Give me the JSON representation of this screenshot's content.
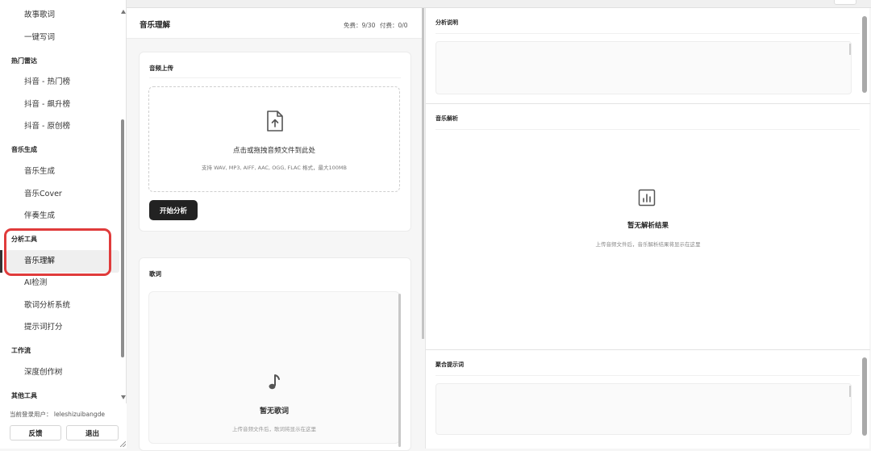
{
  "sidebar": {
    "items": [
      {
        "label": "故事歌词",
        "kind": "item"
      },
      {
        "label": "一键写词",
        "kind": "item"
      },
      {
        "label": "热门雷达",
        "kind": "group"
      },
      {
        "label": "抖音 - 热门榜",
        "kind": "item"
      },
      {
        "label": "抖音 - 飙升榜",
        "kind": "item"
      },
      {
        "label": "抖音 - 原创榜",
        "kind": "item"
      },
      {
        "label": "音乐生成",
        "kind": "group"
      },
      {
        "label": "音乐生成",
        "kind": "item"
      },
      {
        "label": "音乐Cover",
        "kind": "item"
      },
      {
        "label": "伴奏生成",
        "kind": "item"
      },
      {
        "label": "分析工具",
        "kind": "group"
      },
      {
        "label": "音乐理解",
        "kind": "item",
        "active": true
      },
      {
        "label": "AI检测",
        "kind": "item"
      },
      {
        "label": "歌词分析系统",
        "kind": "item"
      },
      {
        "label": "提示词打分",
        "kind": "item"
      },
      {
        "label": "工作流",
        "kind": "group"
      },
      {
        "label": "深度创作树",
        "kind": "item"
      },
      {
        "label": "其他工具",
        "kind": "group"
      }
    ],
    "current_user": "当前登录用户： leleshizuibangde",
    "feedback_label": "反馈",
    "logout_label": "退出"
  },
  "main": {
    "title": "音乐理解",
    "quota_free": "免费：9/30",
    "quota_paid": "付费：0/0",
    "upload_card": {
      "title": "音频上传",
      "drop_main": "点击或拖拽音频文件到此处",
      "drop_sub": "支持 WAV, MP3, AIFF, AAC, OGG, FLAC 格式，最大100MB",
      "analyze_button": "开始分析"
    },
    "lyrics_card": {
      "title": "歌词",
      "empty_title": "暂无歌词",
      "empty_sub": "上传音频文件后，歌词将显示在这里"
    }
  },
  "right": {
    "analysis_desc_title": "分析说明",
    "music_parse_title": "音乐解析",
    "empty_title": "暂无解析结果",
    "empty_sub": "上传音频文件后，音乐解析结果将显示在这里",
    "merged_prompt_title": "聚合提示词"
  },
  "colors": {
    "highlight": "#e03b3b",
    "primary_button": "#222222"
  },
  "icons": [
    "file-upload-icon",
    "music-note-icon",
    "bar-chart-icon"
  ]
}
